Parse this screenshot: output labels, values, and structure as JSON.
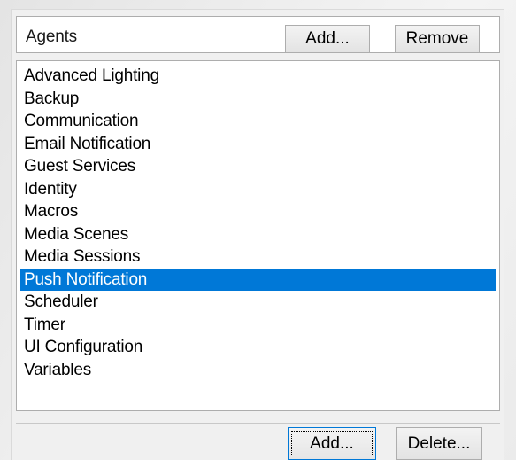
{
  "header": {
    "label": "Agents",
    "add_label": "Add...",
    "remove_label": "Remove"
  },
  "list": {
    "items": [
      "Advanced Lighting",
      "Backup",
      "Communication",
      "Email Notification",
      "Guest Services",
      "Identity",
      "Macros",
      "Media Scenes",
      "Media Sessions",
      "Push Notification",
      "Scheduler",
      "Timer",
      "UI Configuration",
      "Variables"
    ],
    "selected_index": 9
  },
  "footer": {
    "add_label": "Add...",
    "delete_label": "Delete..."
  },
  "colors": {
    "selection": "#0078d7",
    "panel": "#f0f0f0",
    "border": "#adadad"
  }
}
